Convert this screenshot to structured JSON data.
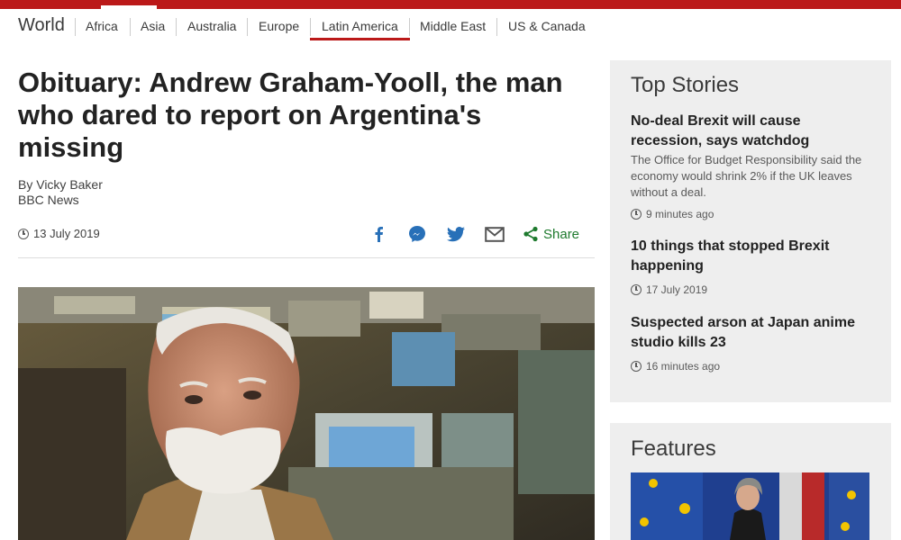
{
  "nav": {
    "section": "World",
    "items": [
      "Africa",
      "Asia",
      "Australia",
      "Europe",
      "Latin America",
      "Middle East",
      "US & Canada"
    ],
    "active": "Latin America"
  },
  "article": {
    "headline": "Obituary: Andrew Graham-Yooll, the man who dared to report on Argentina's missing",
    "author": "By Vicky Baker",
    "outlet": "BBC News",
    "date": "13 July 2019",
    "share_label": "Share",
    "share_icons": [
      "facebook-icon",
      "messenger-icon",
      "twitter-icon",
      "email-icon",
      "share-icon"
    ]
  },
  "sidebar": {
    "top_stories_title": "Top Stories",
    "stories": [
      {
        "title": "No-deal Brexit will cause recession, says watchdog",
        "summary": "The Office for Budget Responsibility said the economy would shrink 2% if the UK leaves without a deal.",
        "time": "9 minutes ago"
      },
      {
        "title": "10 things that stopped Brexit happening",
        "summary": "",
        "time": "17 July 2019"
      },
      {
        "title": "Suspected arson at Japan anime studio kills 23",
        "summary": "",
        "time": "16 minutes ago"
      }
    ],
    "features_title": "Features"
  },
  "colors": {
    "brand_red": "#bb1919",
    "share_green": "#1e7a2e",
    "icon_blue": "#2870b8",
    "sidebar_bg": "#eeeeee"
  }
}
